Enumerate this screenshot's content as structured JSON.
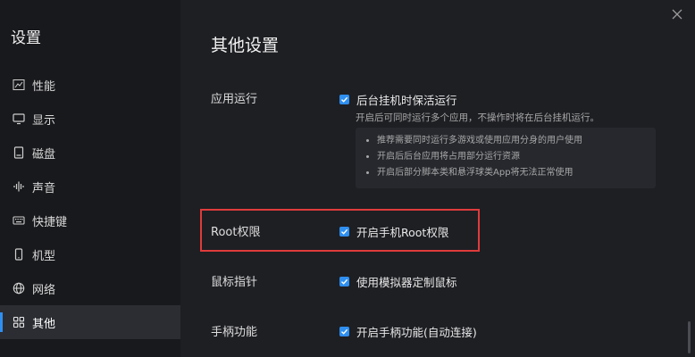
{
  "sidebar": {
    "title": "设置",
    "items": [
      {
        "label": "性能",
        "icon": "chart-line-icon"
      },
      {
        "label": "显示",
        "icon": "monitor-icon"
      },
      {
        "label": "磁盘",
        "icon": "disk-icon"
      },
      {
        "label": "声音",
        "icon": "sound-wave-icon"
      },
      {
        "label": "快捷键",
        "icon": "keyboard-icon"
      },
      {
        "label": "机型",
        "icon": "phone-icon"
      },
      {
        "label": "网络",
        "icon": "globe-icon"
      },
      {
        "label": "其他",
        "icon": "grid-icon",
        "active": true
      }
    ]
  },
  "main": {
    "title": "其他设置",
    "sections": {
      "app_run": {
        "label": "应用运行",
        "option": "后台挂机时保活运行",
        "checked": true,
        "description": "开启后可同时运行多个应用，不操作时将在后台挂机运行。",
        "tips": [
          "推荐需要同时运行多游戏或使用应用分身的用户使用",
          "开启后后台应用将占用部分运行资源",
          "开启后部分脚本类和悬浮球类App将无法正常使用"
        ]
      },
      "root": {
        "label": "Root权限",
        "option": "开启手机Root权限",
        "checked": true
      },
      "mouse": {
        "label": "鼠标指针",
        "option": "使用模拟器定制鼠标",
        "checked": true
      },
      "gamepad": {
        "label": "手柄功能",
        "option": "开启手柄功能(自动连接)",
        "checked": true
      }
    }
  },
  "colors": {
    "accent": "#2f8ff0",
    "highlight": "#e03b3b",
    "background": "#1e1f23",
    "sidebar": "#18191c"
  }
}
